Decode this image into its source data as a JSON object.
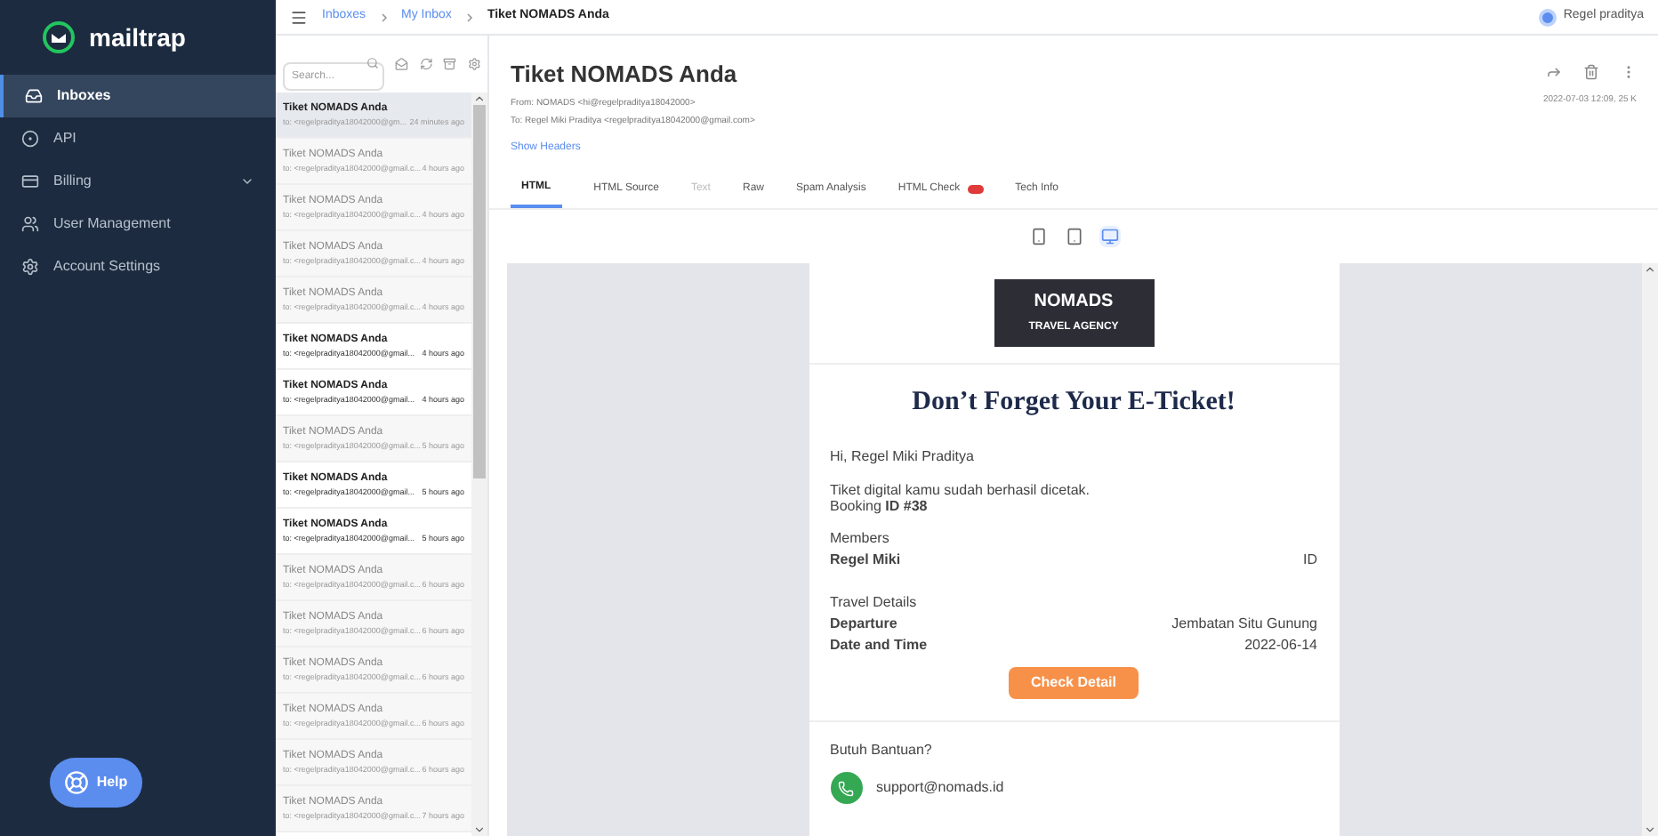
{
  "sidebar": {
    "logo": "mailtrap",
    "items": [
      {
        "label": "Inboxes",
        "selected": true,
        "has_caret": false
      },
      {
        "label": "API",
        "selected": false,
        "has_caret": false
      },
      {
        "label": "Billing",
        "selected": false,
        "has_caret": true
      },
      {
        "label": "User Management",
        "selected": false,
        "has_caret": false
      },
      {
        "label": "Account Settings",
        "selected": false,
        "has_caret": false
      }
    ],
    "help": "Help"
  },
  "breadcrumb": [
    "Inboxes",
    "My Inbox",
    "Tiket NOMADS Anda"
  ],
  "user": "Regel praditya",
  "search": {
    "placeholder": "Search..."
  },
  "messages": [
    {
      "subject": "Tiket NOMADS Anda",
      "to": "to: <regelpraditya18042000@gm...",
      "time": "24 minutes ago",
      "selected": true,
      "unread": false
    },
    {
      "subject": "Tiket NOMADS Anda",
      "to": "to: <regelpraditya18042000@gmail.c...",
      "time": "4 hours ago",
      "selected": false,
      "unread": false
    },
    {
      "subject": "Tiket NOMADS Anda",
      "to": "to: <regelpraditya18042000@gmail.c...",
      "time": "4 hours ago",
      "selected": false,
      "unread": false
    },
    {
      "subject": "Tiket NOMADS Anda",
      "to": "to: <regelpraditya18042000@gmail.c...",
      "time": "4 hours ago",
      "selected": false,
      "unread": false
    },
    {
      "subject": "Tiket NOMADS Anda",
      "to": "to: <regelpraditya18042000@gmail.c...",
      "time": "4 hours ago",
      "selected": false,
      "unread": false
    },
    {
      "subject": "Tiket NOMADS Anda",
      "to": "to: <regelpraditya18042000@gmail...",
      "time": "4 hours ago",
      "selected": false,
      "unread": true
    },
    {
      "subject": "Tiket NOMADS Anda",
      "to": "to: <regelpraditya18042000@gmail...",
      "time": "4 hours ago",
      "selected": false,
      "unread": true
    },
    {
      "subject": "Tiket NOMADS Anda",
      "to": "to: <regelpraditya18042000@gmail.c...",
      "time": "5 hours ago",
      "selected": false,
      "unread": false
    },
    {
      "subject": "Tiket NOMADS Anda",
      "to": "to: <regelpraditya18042000@gmail...",
      "time": "5 hours ago",
      "selected": false,
      "unread": true
    },
    {
      "subject": "Tiket NOMADS Anda",
      "to": "to: <regelpraditya18042000@gmail...",
      "time": "5 hours ago",
      "selected": false,
      "unread": true
    },
    {
      "subject": "Tiket NOMADS Anda",
      "to": "to: <regelpraditya18042000@gmail.c...",
      "time": "6 hours ago",
      "selected": false,
      "unread": false
    },
    {
      "subject": "Tiket NOMADS Anda",
      "to": "to: <regelpraditya18042000@gmail.c...",
      "time": "6 hours ago",
      "selected": false,
      "unread": false
    },
    {
      "subject": "Tiket NOMADS Anda",
      "to": "to: <regelpraditya18042000@gmail.c...",
      "time": "6 hours ago",
      "selected": false,
      "unread": false
    },
    {
      "subject": "Tiket NOMADS Anda",
      "to": "to: <regelpraditya18042000@gmail.c...",
      "time": "6 hours ago",
      "selected": false,
      "unread": false
    },
    {
      "subject": "Tiket NOMADS Anda",
      "to": "to: <regelpraditya18042000@gmail.c...",
      "time": "6 hours ago",
      "selected": false,
      "unread": false
    },
    {
      "subject": "Tiket NOMADS Anda",
      "to": "to: <regelpraditya18042000@gmail.c...",
      "time": "7 hours ago",
      "selected": false,
      "unread": false
    }
  ],
  "email": {
    "subject": "Tiket NOMADS Anda",
    "from": "From: NOMADS <hi@regelpraditya18042000>",
    "to": "To: Regel Miki Praditya <regelpraditya18042000@gmail.com>",
    "date": "2022-07-03 12:09, 25 K",
    "show_headers": "Show Headers",
    "tabs": [
      {
        "label": "HTML",
        "selected": true,
        "disabled": false,
        "badge": false
      },
      {
        "label": "HTML Source",
        "selected": false,
        "disabled": false,
        "badge": false
      },
      {
        "label": "Text",
        "selected": false,
        "disabled": true,
        "badge": false
      },
      {
        "label": "Raw",
        "selected": false,
        "disabled": false,
        "badge": false
      },
      {
        "label": "Spam Analysis",
        "selected": false,
        "disabled": false,
        "badge": false
      },
      {
        "label": "HTML Check",
        "selected": false,
        "disabled": false,
        "badge": true
      },
      {
        "label": "Tech Info",
        "selected": false,
        "disabled": false,
        "badge": false
      }
    ],
    "devices": [
      {
        "kind": "mobile",
        "selected": false
      },
      {
        "kind": "tablet",
        "selected": false
      },
      {
        "kind": "desktop",
        "selected": true
      }
    ]
  },
  "body": {
    "brand": "NOMADS",
    "brand_sub": "TRAVEL AGENCY",
    "heading": "Don’t Forget Your E-Ticket!",
    "greeting": "Hi, Regel Miki Praditya",
    "intro": "Tiket digital kamu sudah berhasil dicetak.",
    "booking": "Booking **ID #38**",
    "members_title": "Members",
    "members": [
      {
        "name": "Regel Miki",
        "value": "ID"
      }
    ],
    "travel_title": "Travel Details",
    "details": [
      {
        "label": "Departure",
        "value": "Jembatan Situ Gunung"
      },
      {
        "label": "Date and Time",
        "value": "2022-06-14"
      }
    ],
    "button": "Check Detail",
    "help": "Butuh Bantuan?",
    "support": "support@nomads.id"
  }
}
